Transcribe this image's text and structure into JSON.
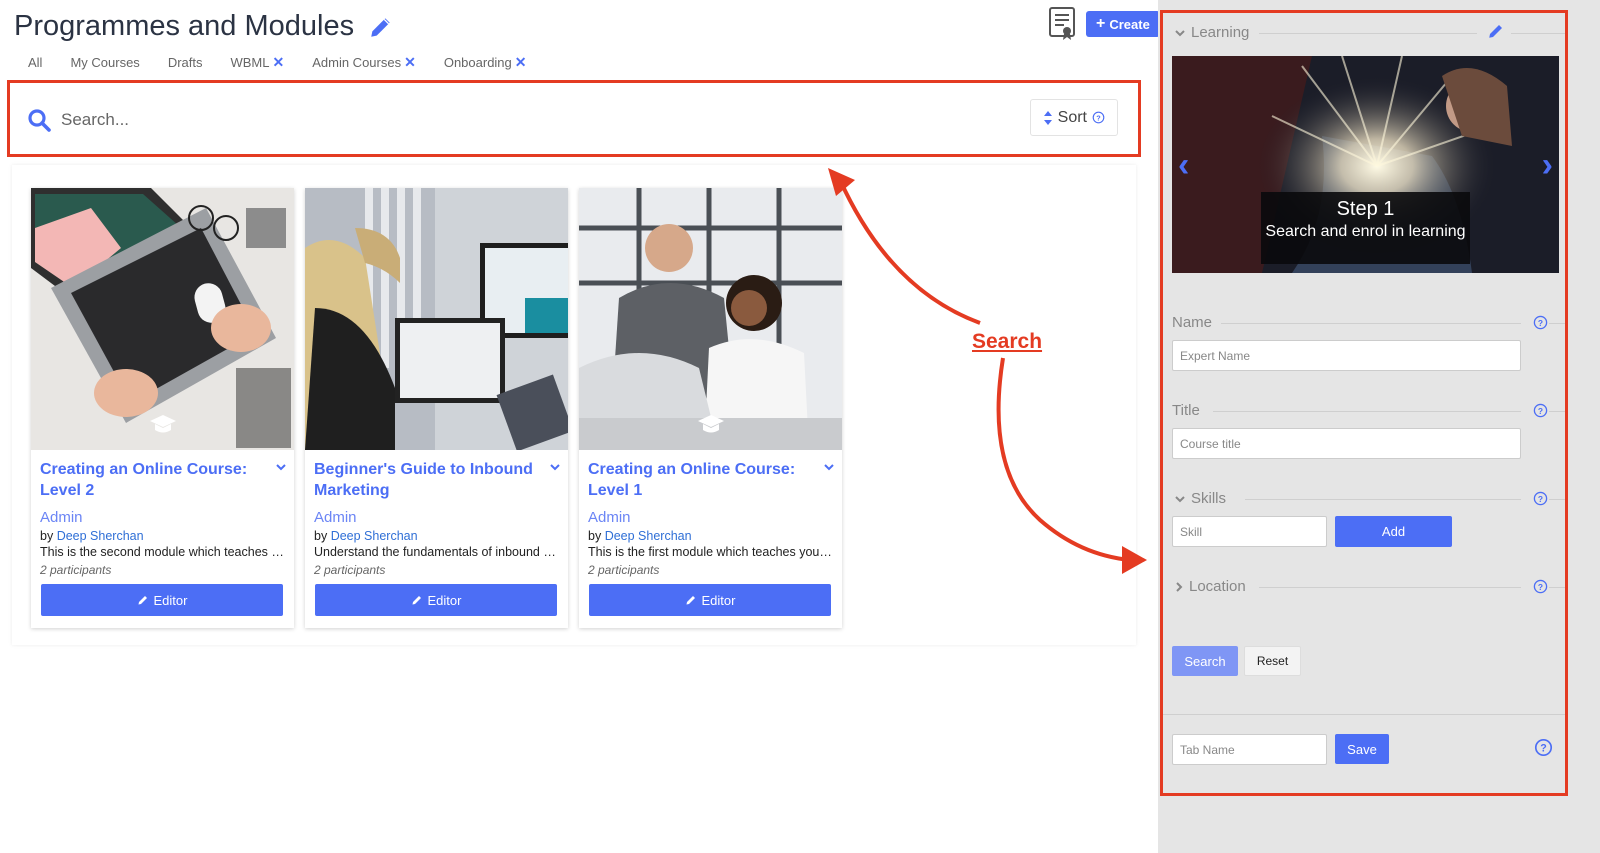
{
  "header": {
    "title": "Programmes and Modules",
    "create_label": "Create"
  },
  "tabs": [
    {
      "label": "All",
      "removable": false
    },
    {
      "label": "My Courses",
      "removable": false
    },
    {
      "label": "Drafts",
      "removable": false
    },
    {
      "label": "WBML",
      "removable": true
    },
    {
      "label": "Admin Courses",
      "removable": true
    },
    {
      "label": "Onboarding",
      "removable": true
    }
  ],
  "search": {
    "placeholder": "Search...",
    "sort_label": "Sort"
  },
  "cards": [
    {
      "title": "Creating an Online Course: Level 2",
      "role": "Admin",
      "by": "by",
      "author": "Deep Sherchan",
      "description": "This is the second module which teaches you how to create an online course",
      "participants": "2 participants",
      "editor_label": "Editor"
    },
    {
      "title": "Beginner's Guide to Inbound Marketing",
      "role": "Admin",
      "by": "by",
      "author": "Deep Sherchan",
      "description": "Understand the fundamentals of inbound marketing and how to use it",
      "participants": "2 participants",
      "editor_label": "Editor"
    },
    {
      "title": "Creating an Online Course: Level 1",
      "role": "Admin",
      "by": "by",
      "author": "Deep Sherchan",
      "description": "This is the first module which teaches you how to create an online course",
      "participants": "2 participants",
      "editor_label": "Editor"
    }
  ],
  "annotation": {
    "label": "Search"
  },
  "sidebar": {
    "section_title": "Learning",
    "carousel": {
      "step_title": "Step 1",
      "step_text": "Search and enrol in learning"
    },
    "name": {
      "label": "Name",
      "placeholder": "Expert Name"
    },
    "title": {
      "label": "Title",
      "placeholder": "Course title"
    },
    "skills": {
      "label": "Skills",
      "placeholder": "Skill",
      "add_label": "Add"
    },
    "location": {
      "label": "Location"
    },
    "search_label": "Search",
    "reset_label": "Reset",
    "tab_name": {
      "placeholder": "Tab Name",
      "save_label": "Save"
    }
  },
  "colors": {
    "accent": "#4c6ef5",
    "annotation": "#e43b22",
    "sidebar_bg": "#e5e5e5"
  },
  "icons": [
    "pencil-icon",
    "certificate-icon",
    "plus-icon",
    "close-icon",
    "search-icon",
    "sort-icon",
    "help-icon",
    "chevron-down-icon",
    "chevron-right-icon",
    "graduation-cap-icon",
    "arrow-left-icon",
    "arrow-right-icon"
  ]
}
